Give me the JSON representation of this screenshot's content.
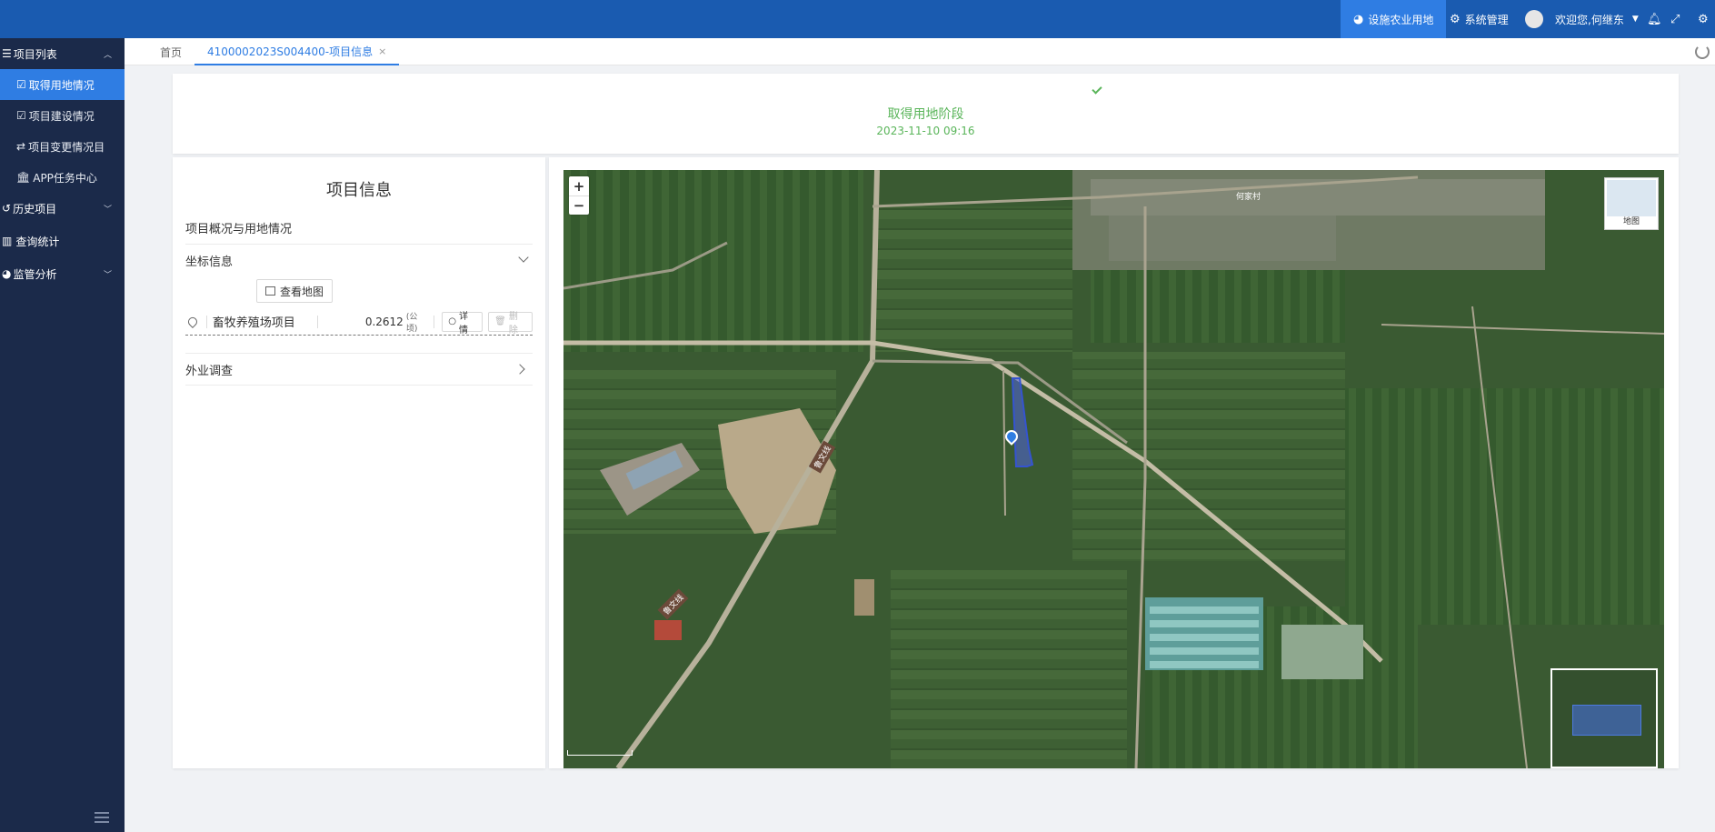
{
  "header": {
    "menus": [
      {
        "label": "设施农业用地",
        "icon": "pie-chart-icon",
        "active": true
      },
      {
        "label": "系统管理",
        "icon": "gears-icon",
        "active": false
      }
    ],
    "welcome": "欢迎您,何继东"
  },
  "sidebar": {
    "groups": [
      {
        "label": "项目列表",
        "icon": "list-icon"
      },
      {
        "label": "历史项目",
        "icon": "history-icon"
      },
      {
        "label": "查询统计",
        "icon": "bar-chart-icon"
      },
      {
        "label": "监管分析",
        "icon": "pie-chart-icon"
      }
    ],
    "subitems": [
      {
        "label": "取得用地情况",
        "icon": "checkbox-icon",
        "active": true
      },
      {
        "label": "项目建设情况",
        "icon": "checkbox-icon",
        "active": false
      },
      {
        "label": "项目变更情况目",
        "icon": "exchange-icon",
        "active": false
      },
      {
        "label": "APP任务中心",
        "icon": "bank-icon",
        "active": false
      }
    ]
  },
  "tabs": [
    {
      "label": "首页"
    },
    {
      "label": "4100002023S004400-项目信息",
      "close": "×"
    }
  ],
  "stage": {
    "title": "取得用地阶段",
    "time": "2023-11-10 09:16"
  },
  "info": {
    "title": "项目信息",
    "section_overview": "项目概况与用地情况",
    "section_coords": "坐标信息",
    "view_map_label": "查看地图",
    "item": {
      "name": "畜牧养殖场项目",
      "area": "0.2612",
      "unit": "(公顷)",
      "detail_label": "详情",
      "delete_label": "删除"
    },
    "section_survey": "外业调查"
  },
  "map": {
    "zoom_in": "+",
    "zoom_out": "−",
    "layer_label": "地图",
    "road_label_1": "鲁文线",
    "road_label_2": "鲁文线",
    "village_label": "何家村"
  }
}
